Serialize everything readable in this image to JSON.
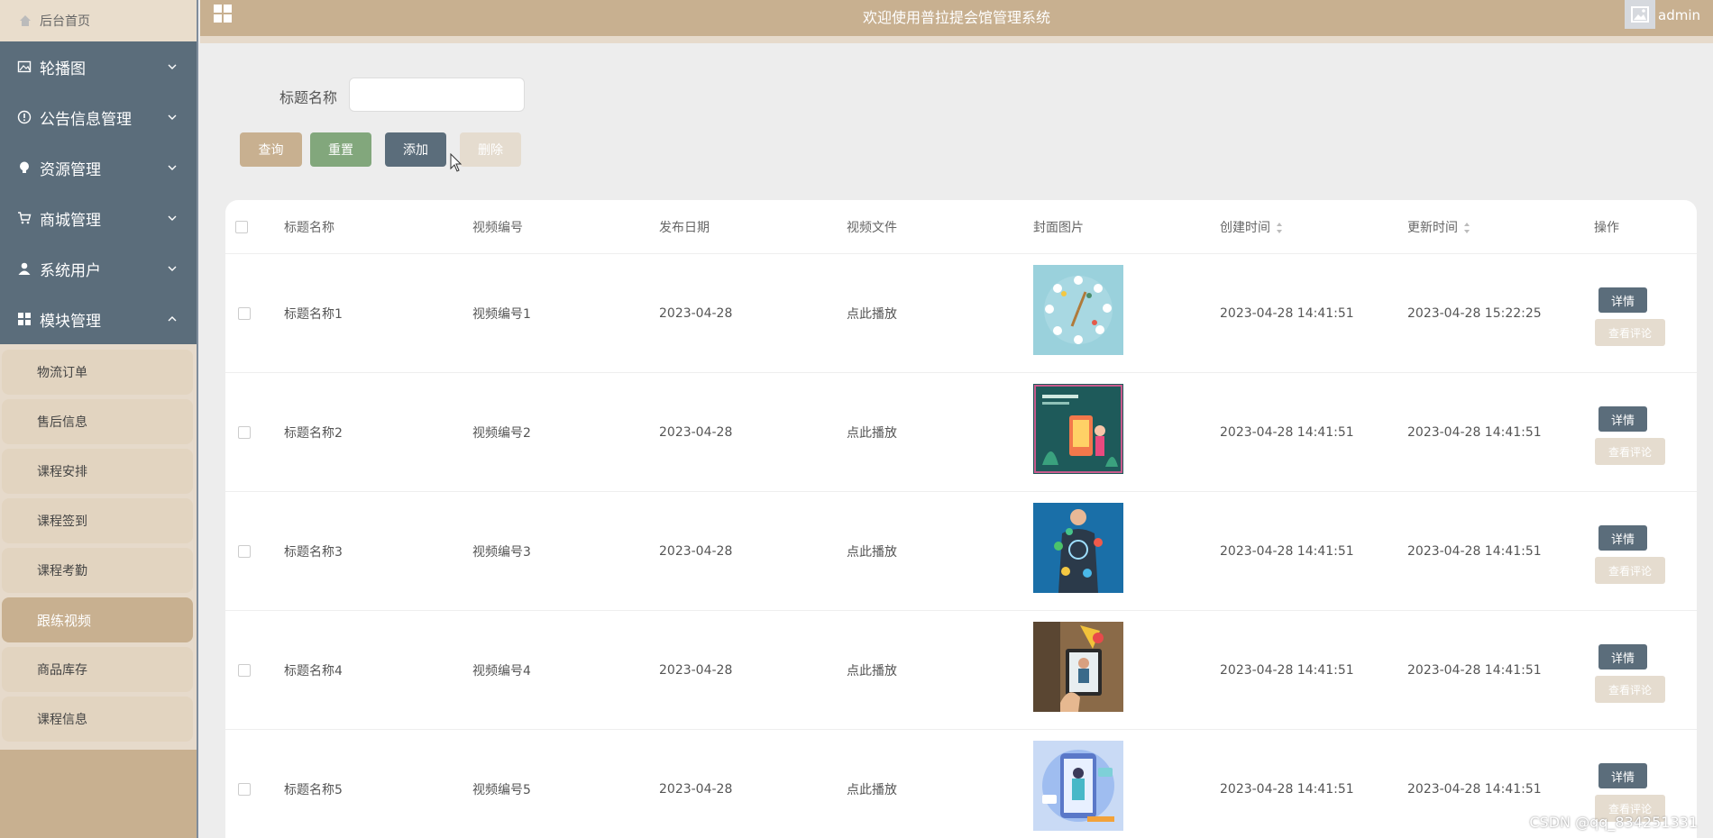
{
  "sidebar": {
    "home": "后台首页",
    "menus": [
      {
        "label": "轮播图",
        "icon": "image-icon"
      },
      {
        "label": "公告信息管理",
        "icon": "info-circle-icon"
      },
      {
        "label": "资源管理",
        "icon": "bulb-icon"
      },
      {
        "label": "商城管理",
        "icon": "cart-icon"
      },
      {
        "label": "系统用户",
        "icon": "user-icon"
      },
      {
        "label": "模块管理",
        "icon": "grid-icon"
      }
    ],
    "submenu": [
      "物流订单",
      "售后信息",
      "课程安排",
      "课程签到",
      "课程考勤",
      "跟练视频",
      "商品库存",
      "课程信息"
    ],
    "active_submenu": "跟练视频"
  },
  "header": {
    "title": "欢迎使用普拉提会馆管理系统",
    "user": "admin"
  },
  "search": {
    "label": "标题名称",
    "value": "",
    "buttons": {
      "query": "查询",
      "reset": "重置",
      "add": "添加",
      "delete": "删除"
    }
  },
  "table": {
    "headers": [
      "标题名称",
      "视频编号",
      "发布日期",
      "视频文件",
      "封面图片",
      "创建时间",
      "更新时间",
      "操作"
    ],
    "rows": [
      {
        "title": "标题名称1",
        "video_no": "视频编号1",
        "publish_date": "2023-04-28",
        "file": "点此播放",
        "created": "2023-04-28 14:41:51",
        "updated": "2023-04-28 15:22:25"
      },
      {
        "title": "标题名称2",
        "video_no": "视频编号2",
        "publish_date": "2023-04-28",
        "file": "点此播放",
        "created": "2023-04-28 14:41:51",
        "updated": "2023-04-28 14:41:51"
      },
      {
        "title": "标题名称3",
        "video_no": "视频编号3",
        "publish_date": "2023-04-28",
        "file": "点此播放",
        "created": "2023-04-28 14:41:51",
        "updated": "2023-04-28 14:41:51"
      },
      {
        "title": "标题名称4",
        "video_no": "视频编号4",
        "publish_date": "2023-04-28",
        "file": "点此播放",
        "created": "2023-04-28 14:41:51",
        "updated": "2023-04-28 14:41:51"
      },
      {
        "title": "标题名称5",
        "video_no": "视频编号5",
        "publish_date": "2023-04-28",
        "file": "点此播放",
        "created": "2023-04-28 14:41:51",
        "updated": "2023-04-28 14:41:51"
      }
    ],
    "actions": {
      "detail": "详情",
      "review": "查看评论"
    }
  },
  "watermark": "CSDN @qq_834251331",
  "colors": {
    "brand": "#c8b090",
    "menu": "#5b6d7b",
    "reset": "#82a77c"
  }
}
